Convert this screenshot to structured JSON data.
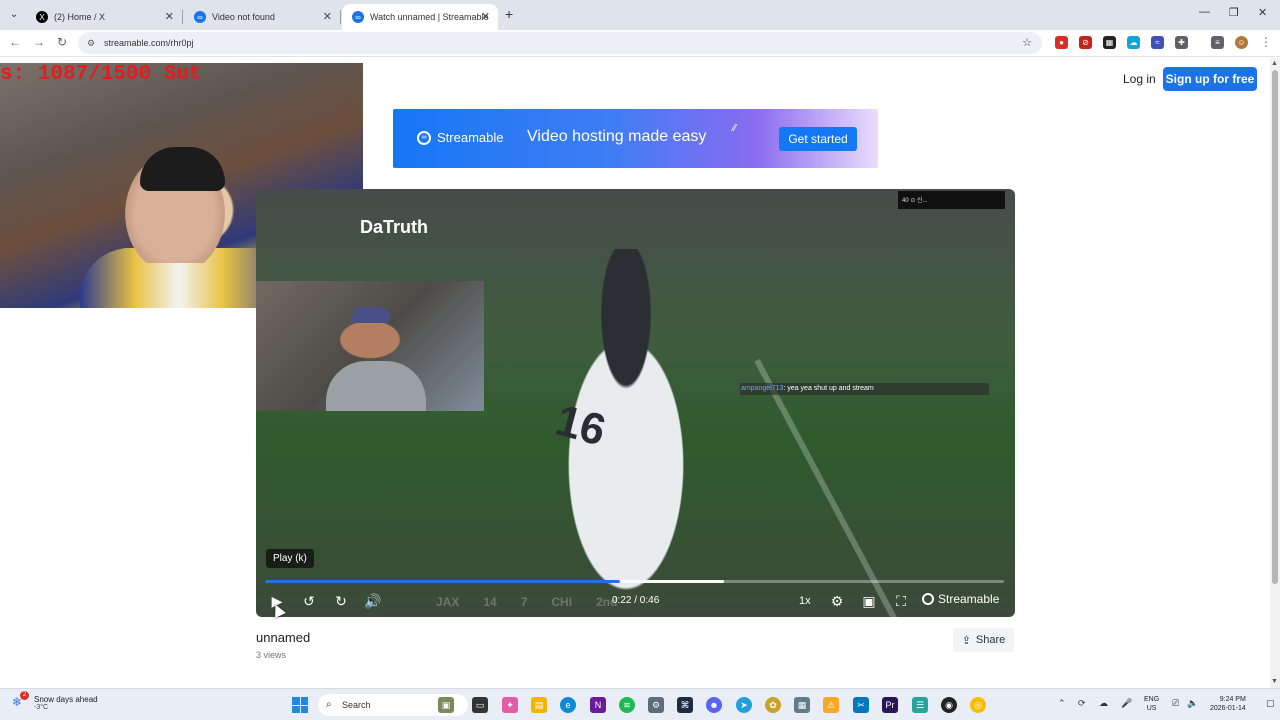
{
  "browser": {
    "tabs": [
      {
        "title": "(2) Home / X",
        "favicon": "x-logo-icon",
        "active": false
      },
      {
        "title": "Video not found",
        "favicon": "streamable-icon",
        "active": false
      },
      {
        "title": "Watch unnamed | Streamable",
        "favicon": "streamable-icon",
        "active": true
      }
    ],
    "new_tab": "+",
    "window_controls": {
      "minimize": "—",
      "restore": "❐",
      "close": "✕"
    },
    "url": "streamable.com/rhr0pj"
  },
  "header": {
    "login_label": "Log in",
    "signup_label": "Sign up for free"
  },
  "banner": {
    "brand": "Streamable",
    "tagline": "Video hosting made easy",
    "cta_label": "Get started",
    "colors": {
      "start": "#1677f5",
      "end": "#e9ddfb"
    }
  },
  "stream_overlay": {
    "counter_text": "s: 1087/1500  Sut",
    "counter_color": "#e11d1d"
  },
  "video": {
    "channel_text": "DaTruth",
    "mini_overlay_text": "40 ⊙ 신...",
    "jersey_number": "16",
    "chat": {
      "user": "ampangel713",
      "message": ": yea yea shut up and stream"
    },
    "scorebug": [
      "JAX",
      "14",
      "7",
      "CHI",
      "2nd"
    ],
    "tooltip": "Play (k)",
    "current_time": "0:22",
    "duration": "0:46",
    "time_display": "0:22 / 0:46",
    "progress_fraction": 0.48,
    "buffered_fraction": 0.62,
    "speed_label": "1x",
    "brand": "Streamable",
    "accent": "#1a73e8"
  },
  "video_info": {
    "title": "unnamed",
    "views": "3 views",
    "share_label": "Share"
  },
  "taskbar": {
    "weather_title": "Snow days ahead",
    "weather_temp": "-3°C",
    "weather_badge": "2",
    "search_placeholder": "Search",
    "lang_top": "ENG",
    "lang_bottom": "US",
    "time": "9:24 PM",
    "date": "2026-01-14"
  }
}
